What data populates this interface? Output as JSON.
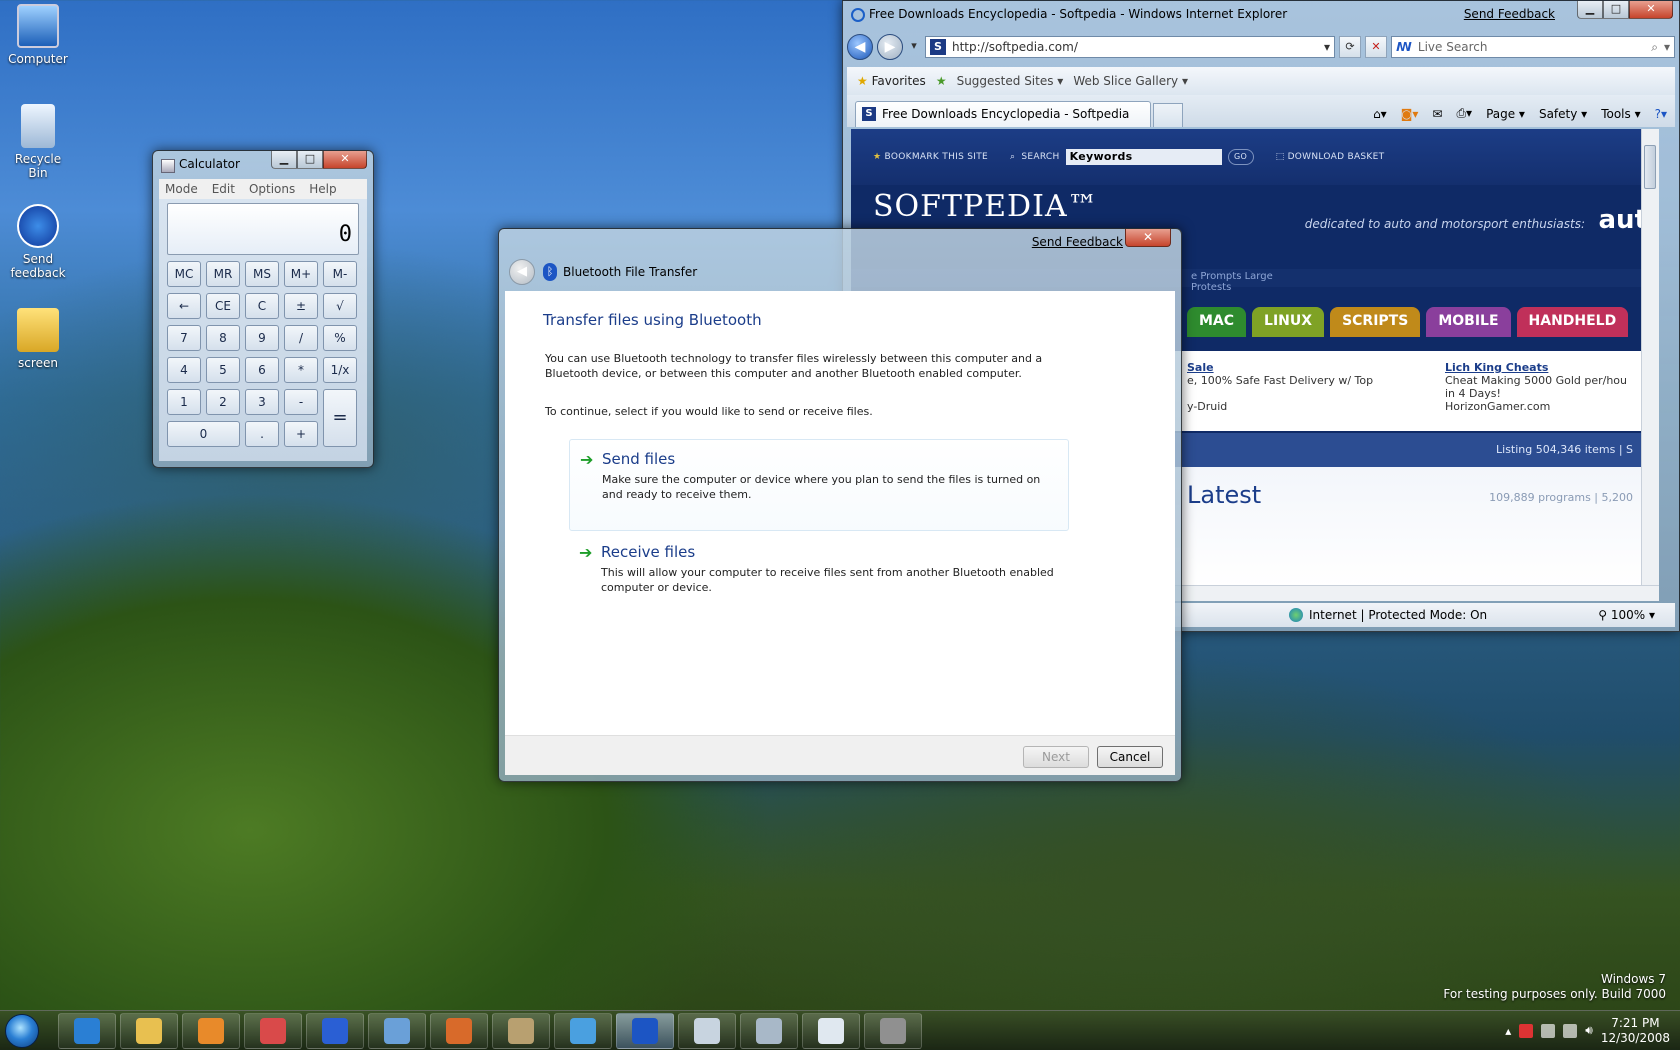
{
  "desktop": {
    "icons": [
      {
        "label": "Computer"
      },
      {
        "label": "Recycle Bin"
      },
      {
        "label": "Send feedback"
      },
      {
        "label": "screen"
      }
    ],
    "watermark": {
      "line1": "Windows 7",
      "line2": "For testing purposes only. Build 7000"
    }
  },
  "calculator": {
    "title": "Calculator",
    "menu": [
      "Mode",
      "Edit",
      "Options",
      "Help"
    ],
    "display": "0",
    "keys": [
      "MC",
      "MR",
      "MS",
      "M+",
      "M-",
      "←",
      "CE",
      "C",
      "±",
      "√",
      "7",
      "8",
      "9",
      "/",
      "%",
      "4",
      "5",
      "6",
      "*",
      "1/x",
      "1",
      "2",
      "3",
      "-",
      "=",
      "0",
      ".",
      "+"
    ]
  },
  "ie": {
    "title": "Free Downloads Encyclopedia - Softpedia - Windows Internet Explorer",
    "send_feedback": "Send Feedback",
    "address": "http://softpedia.com/",
    "search_placeholder": "Live Search",
    "favorites": "Favorites",
    "suggested_sites": "Suggested Sites ▾",
    "web_slice": "Web Slice Gallery ▾",
    "tab_title": "Free Downloads Encyclopedia - Softpedia",
    "commands": {
      "page": "Page ▾",
      "safety": "Safety ▾",
      "tools": "Tools ▾"
    },
    "status_zone": "Internet | Protected Mode: On",
    "zoom": "100%",
    "site": {
      "bookmark": "BOOKMARK THIS SITE",
      "search": "SEARCH",
      "keywords": "Keywords",
      "go": "GO",
      "download_basket": "DOWNLOAD BASKET",
      "logo": "SOFTPEDIA™",
      "tagline": "dedicated to auto and motorsport enthusiasts:",
      "tagline_brand": "aut",
      "news_strip": "e Prompts Large Protests",
      "categories": [
        {
          "label": "MAC",
          "color": "#2e8b2e"
        },
        {
          "label": "LINUX",
          "color": "#7fa225"
        },
        {
          "label": "SCRIPTS",
          "color": "#c08a1a"
        },
        {
          "label": "MOBILE",
          "color": "#8a3f9c"
        },
        {
          "label": "HANDHELD",
          "color": "#c0305a"
        }
      ],
      "ad1": {
        "title": "Sale",
        "line1": "e, 100% Safe Fast Delivery w/ Top",
        "line2": "y-Druid"
      },
      "ad2": {
        "title": "Lich King Cheats",
        "line1": "Cheat Making 5000 Gold per/hou",
        "line2": "in 4 Days!",
        "line3": "HorizonGamer.com"
      },
      "listing": "Listing 504,346 items | S",
      "latest": "Latest",
      "latest_sub": "109,889 programs | 5,200"
    }
  },
  "bluetooth": {
    "window_title": "Bluetooth File Transfer",
    "send_feedback": "Send Feedback",
    "heading": "Transfer files using Bluetooth",
    "intro": "You can use Bluetooth technology to transfer files wirelessly between this computer and a Bluetooth device, or between this computer and another Bluetooth enabled computer.",
    "prompt": "To continue, select if you would like to send or receive files.",
    "options": [
      {
        "title": "Send files",
        "desc": "Make sure the computer or device where you plan to send the files is turned on and ready to receive them."
      },
      {
        "title": "Receive files",
        "desc": "This will allow your computer to receive files sent from another Bluetooth enabled computer or device."
      }
    ],
    "next_label": "Next",
    "cancel_label": "Cancel"
  },
  "taskbar": {
    "items": [
      {
        "name": "internet-explorer",
        "color": "#2a7fd4"
      },
      {
        "name": "windows-explorer",
        "color": "#e8c050"
      },
      {
        "name": "media-player",
        "color": "#e88a2a"
      },
      {
        "name": "paint",
        "color": "#d94a4a"
      },
      {
        "name": "help",
        "color": "#2a5fd4"
      },
      {
        "name": "wordpad",
        "color": "#6aa0d8"
      },
      {
        "name": "gadgets",
        "color": "#d86a2a"
      },
      {
        "name": "tools",
        "color": "#b8a070"
      },
      {
        "name": "messenger",
        "color": "#4aa0e0"
      },
      {
        "name": "bluetooth",
        "color": "#1c55c4",
        "active": true
      },
      {
        "name": "calculator",
        "color": "#c8d4e0"
      },
      {
        "name": "network",
        "color": "#a8b8c8"
      },
      {
        "name": "notepad",
        "color": "#e0e8f0"
      },
      {
        "name": "sound-recorder",
        "color": "#909090"
      }
    ],
    "clock_time": "7:21 PM",
    "clock_date": "12/30/2008"
  }
}
